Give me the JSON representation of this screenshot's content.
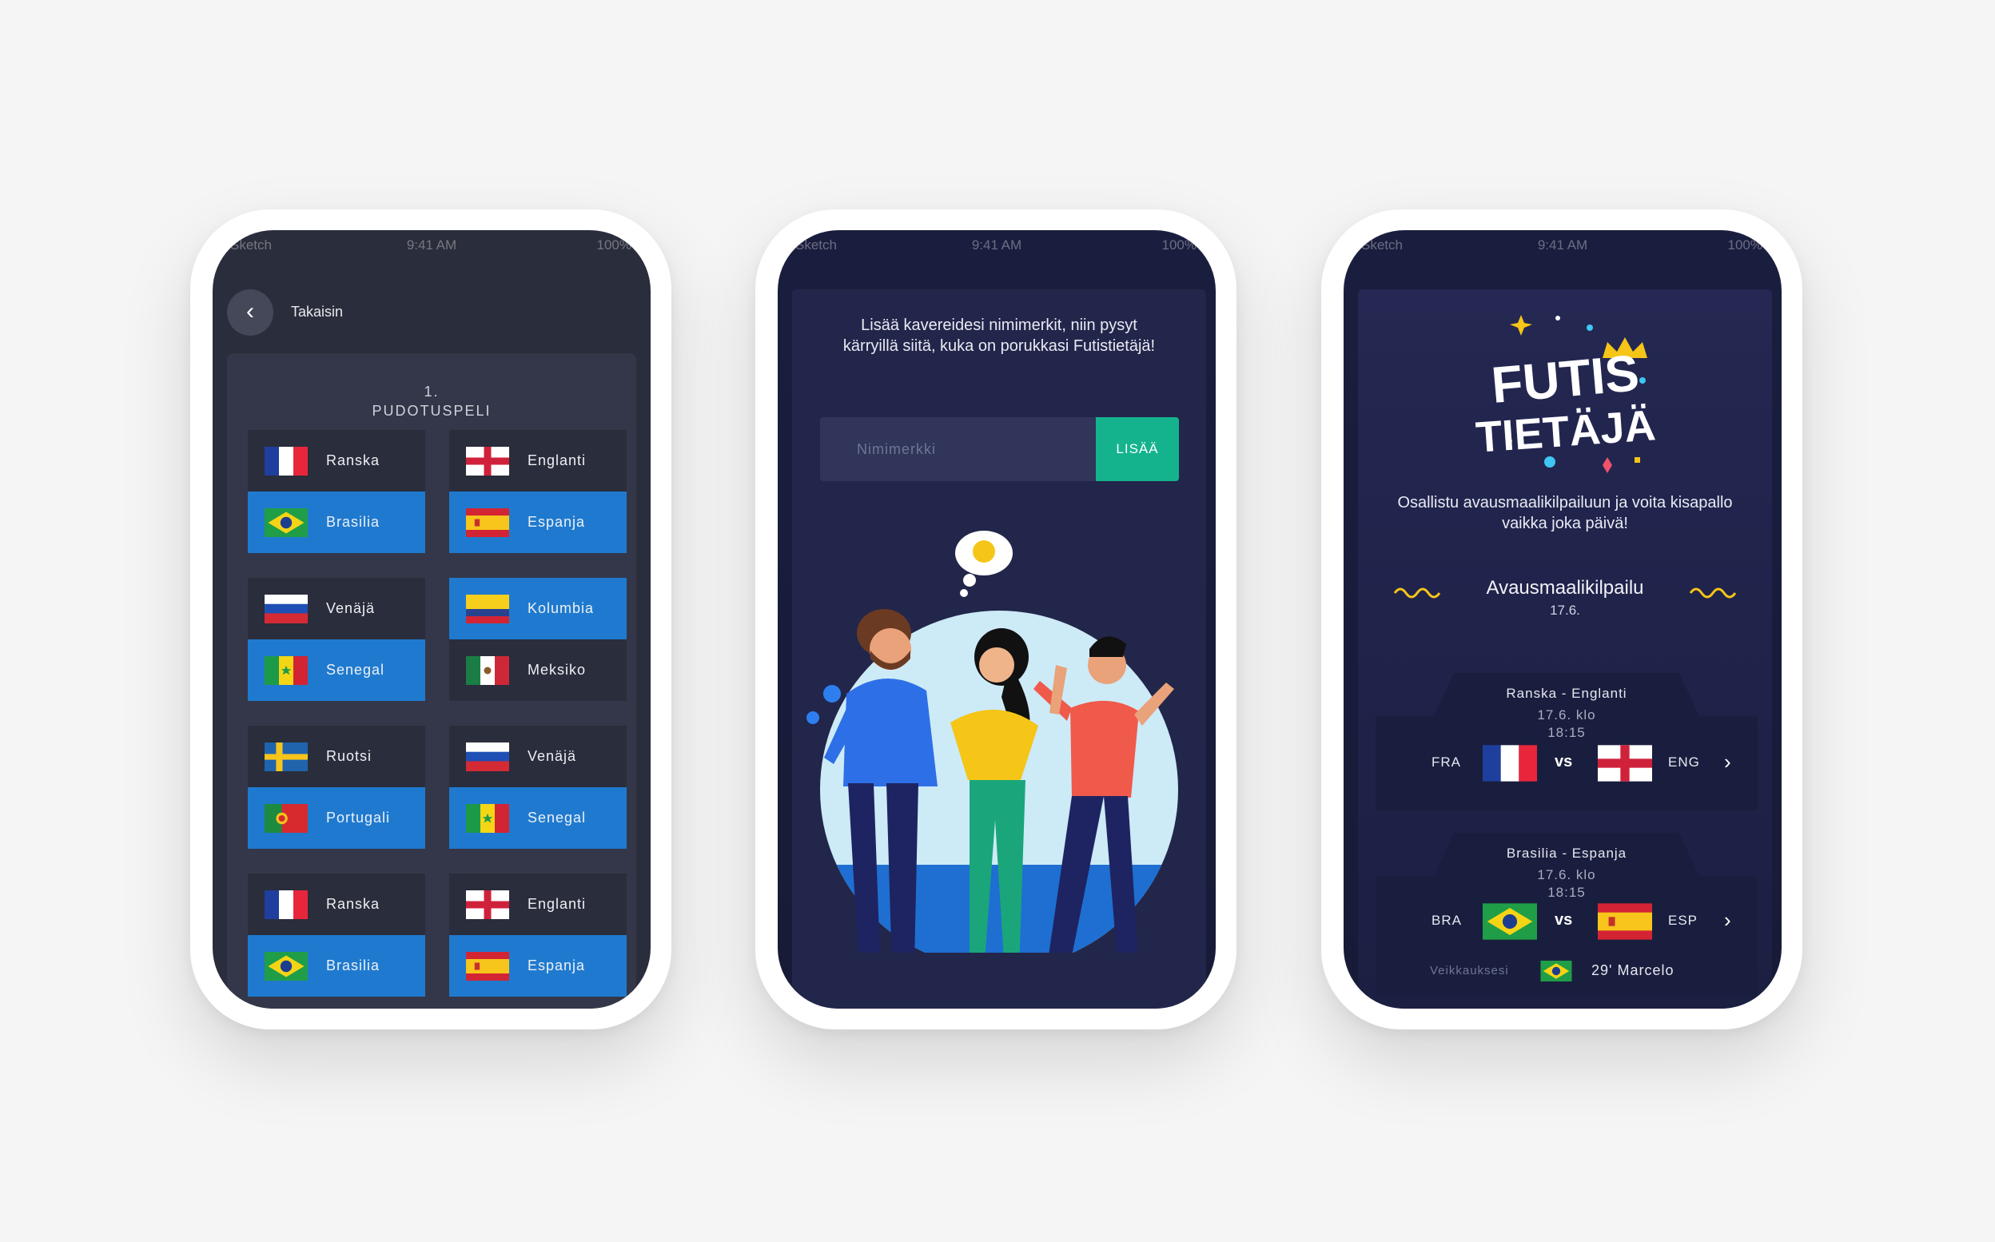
{
  "status_bar": {
    "carrier": "Sketch",
    "time": "9:41 AM",
    "battery": "100%"
  },
  "screen1": {
    "back_label": "Takaisin",
    "round_number": "1.",
    "round_title": "PUDOTUSPELI",
    "matches": [
      {
        "home": "Ranska",
        "away": "Brasilia"
      },
      {
        "home": "Englanti",
        "away": "Espanja"
      },
      {
        "home": "Venäjä",
        "away": "Senegal"
      },
      {
        "home": "Kolumbia",
        "away": "Meksiko"
      },
      {
        "home": "Ruotsi",
        "away": "Portugali"
      },
      {
        "home": "Venäjä",
        "away": "Senegal"
      },
      {
        "home": "Ranska",
        "away": "Brasilia"
      },
      {
        "home": "Englanti",
        "away": "Espanja"
      }
    ]
  },
  "screen2": {
    "intro_text": "Lisää kavereidesi nimimerkit, niin pysyt kärryillä siitä, kuka on porukkasi Futistietäjä!",
    "nickname_placeholder": "Nimimerkki",
    "add_button": "LISÄÄ"
  },
  "screen3": {
    "logo_line1": "FUTIS",
    "logo_line2": "TIETÄJÄ",
    "tagline": "Osallistu avausmaalikilpailuun ja voita kisapallo vaikka joka päivä!",
    "competition_title": "Avausmaalikilpailu",
    "competition_date": "17.6.",
    "matches": [
      {
        "title": "Ranska - Englanti",
        "date": "17.6. klo",
        "time": "18:15",
        "home_code": "FRA",
        "away_code": "ENG",
        "vs": "vs"
      },
      {
        "title": "Brasilia - Espanja",
        "date": "17.6. klo",
        "time": "18:15",
        "home_code": "BRA",
        "away_code": "ESP",
        "vs": "vs",
        "guess_label": "Veikkauksesi",
        "guess_value": "29' Marcelo"
      }
    ]
  },
  "colors": {
    "accent_blue": "#1f7acf",
    "accent_green": "#14b38e",
    "dark_bg": "#2a2d3b",
    "navy_bg": "#1a1e3e"
  }
}
